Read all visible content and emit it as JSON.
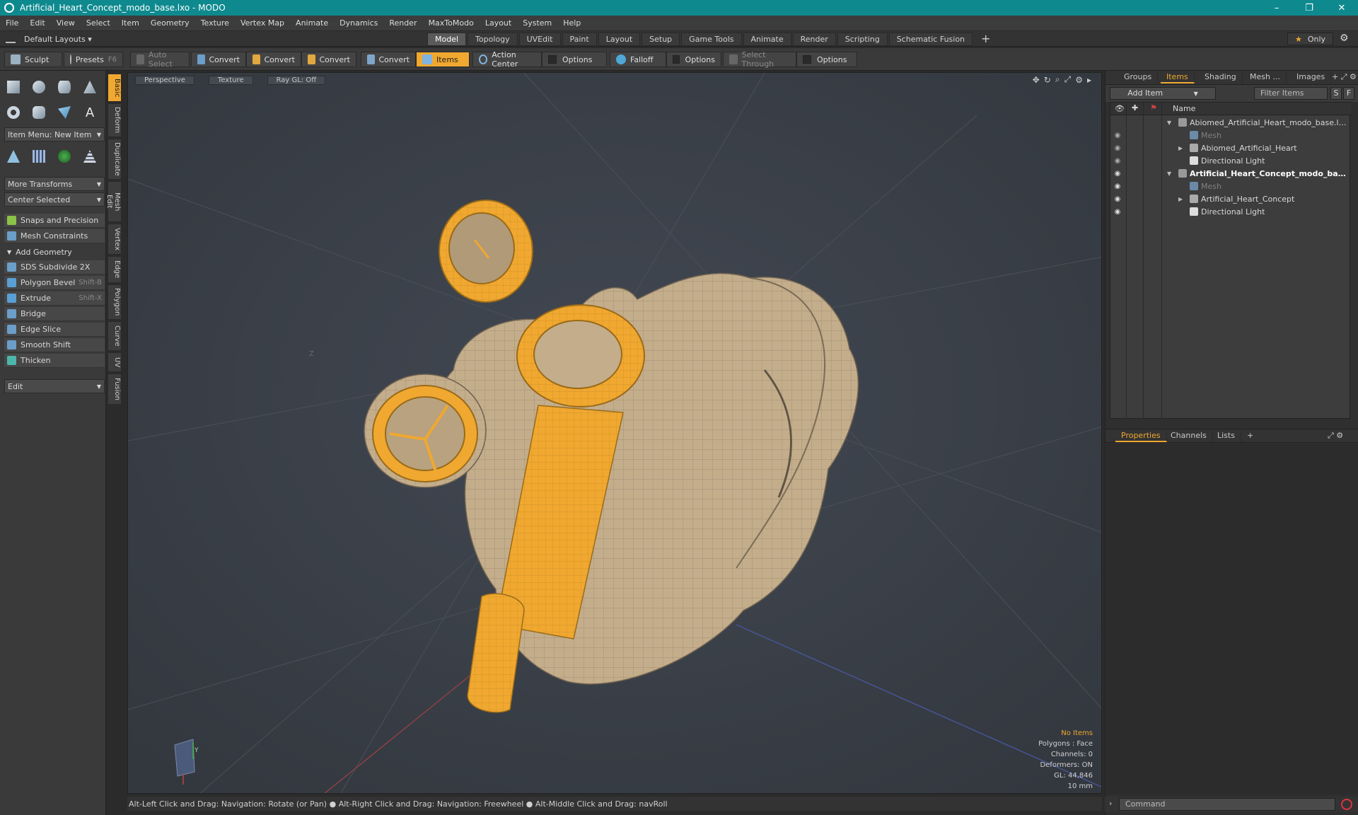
{
  "window": {
    "title": "Artificial_Heart_Concept_modo_base.lxo - MODO",
    "controls": {
      "minimize": "–",
      "restore": "❐",
      "close": "✕"
    }
  },
  "menu": [
    "File",
    "Edit",
    "View",
    "Select",
    "Item",
    "Geometry",
    "Texture",
    "Vertex Map",
    "Animate",
    "Dynamics",
    "Render",
    "MaxToModo",
    "Layout",
    "System",
    "Help"
  ],
  "layout": {
    "default_layouts": "Default Layouts ▾",
    "tabs": [
      "Model",
      "Topology",
      "UVEdit",
      "Paint",
      "Layout",
      "Setup",
      "Game Tools",
      "Animate",
      "Render",
      "Scripting",
      "Schematic Fusion"
    ],
    "active_tab": "Model",
    "plus": "+",
    "only": "Only",
    "star": "★",
    "gear": "⚙"
  },
  "toolbar": {
    "sculpt": "Sculpt",
    "presets": "Presets",
    "presets_shortcut": "F6",
    "auto_select": "Auto Select",
    "convert1": "Convert",
    "convert2": "Convert",
    "convert3": "Convert",
    "convert4": "Convert",
    "items": "Items",
    "action_center": "Action Center",
    "options1": "Options",
    "falloff": "Falloff",
    "options2": "Options",
    "select_through": "Select Through",
    "options3": "Options"
  },
  "left": {
    "item_menu": "Item Menu: New Item",
    "more_transforms": "More Transforms",
    "center_selected": "Center Selected",
    "snaps": "Snaps and Precision",
    "constraints": "Mesh Constraints",
    "add_geometry": "Add Geometry",
    "tools": [
      {
        "label": "SDS Subdivide 2X",
        "shortcut": ""
      },
      {
        "label": "Polygon Bevel",
        "shortcut": "Shift-B"
      },
      {
        "label": "Extrude",
        "shortcut": "Shift-X"
      },
      {
        "label": "Bridge",
        "shortcut": ""
      },
      {
        "label": "Edge Slice",
        "shortcut": ""
      },
      {
        "label": "Smooth Shift",
        "shortcut": ""
      },
      {
        "label": "Thicken",
        "shortcut": ""
      }
    ],
    "edit": "Edit"
  },
  "vtabs": [
    "Basic",
    "Deform",
    "Duplicate",
    "Mesh Edit",
    "Vertex",
    "Edge",
    "Polygon",
    "Curve",
    "UV",
    "Fusion"
  ],
  "viewport": {
    "view": "Perspective",
    "shading": "Texture",
    "raygl": "Ray GL: Off",
    "info": {
      "no_items": "No Items",
      "polygons": "Polygons : Face",
      "channels": "Channels: 0",
      "deformers": "Deformers: ON",
      "gl": "GL: 44,846",
      "scale": "10 mm"
    },
    "axis_y": "Y",
    "axis_z": "Z"
  },
  "status": "Alt-Left Click and Drag: Navigation: Rotate (or Pan) ● Alt-Right Click and Drag: Navigation: Freewheel ● Alt-Middle Click and Drag: navRoll",
  "right": {
    "tabs": [
      "Groups",
      "Items",
      "Shading",
      "Mesh ...",
      "Images"
    ],
    "active_tab": "Items",
    "add_item": "Add Item",
    "filter": "Filter Items",
    "s": "S",
    "f": "F",
    "col_name": "Name",
    "tree": [
      {
        "label": "Abiomed_Artificial_Heart_modo_base.lxo*",
        "level": 0,
        "tri": "▼",
        "style": ""
      },
      {
        "label": "Mesh",
        "level": 1,
        "tri": "",
        "style": "dim"
      },
      {
        "label": "Abiomed_Artificial_Heart",
        "level": 1,
        "tri": "▶",
        "style": ""
      },
      {
        "label": "Directional Light",
        "level": 1,
        "tri": "",
        "style": ""
      },
      {
        "label": "Artificial_Heart_Concept_modo_bas...",
        "level": 0,
        "tri": "▼",
        "style": "bold"
      },
      {
        "label": "Mesh",
        "level": 1,
        "tri": "",
        "style": "dim"
      },
      {
        "label": "Artificial_Heart_Concept",
        "level": 1,
        "tri": "▶",
        "style": ""
      },
      {
        "label": "Directional Light",
        "level": 1,
        "tri": "",
        "style": ""
      }
    ],
    "prop_tabs": [
      "Properties",
      "Channels",
      "Lists"
    ],
    "prop_active": "Properties",
    "command": "Command"
  },
  "colors": {
    "accent": "#f0a830",
    "titlebar": "#0e8a8f",
    "mesh": "#c3ad8b",
    "selected": "#f0a830"
  }
}
